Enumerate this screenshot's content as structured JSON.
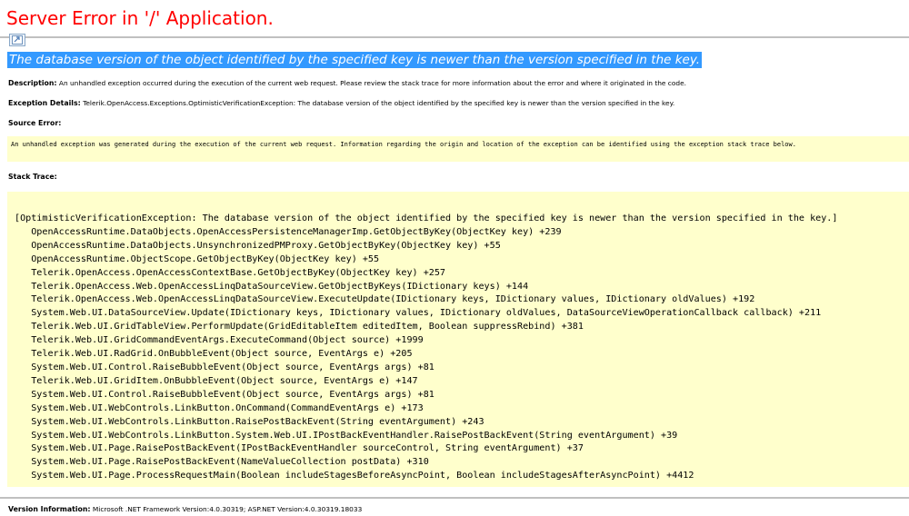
{
  "page": {
    "title": "Server Error in '/' Application.",
    "error_message": "The database version of the object identified by the specified key is newer than the version specified in the key."
  },
  "description": {
    "label": "Description:",
    "text": "An unhandled exception occurred during the execution of the current web request. Please review the stack trace for more information about the error and where it originated in the code."
  },
  "exception_details": {
    "label": "Exception Details:",
    "text": "Telerik.OpenAccess.Exceptions.OptimisticVerificationException: The database version of the object identified by the specified key is newer than the version specified in the key."
  },
  "source_error": {
    "label": "Source Error:",
    "text": "An unhandled exception was generated during the execution of the current web request. Information regarding the origin and location of the exception can be identified using the exception stack trace below."
  },
  "stack_trace": {
    "label": "Stack Trace:",
    "lines": [
      "[OptimisticVerificationException: The database version of the object identified by the specified key is newer than the version specified in the key.]",
      "   OpenAccessRuntime.DataObjects.OpenAccessPersistenceManagerImp.GetObjectByKey(ObjectKey key) +239",
      "   OpenAccessRuntime.DataObjects.UnsynchronizedPMProxy.GetObjectByKey(ObjectKey key) +55",
      "   OpenAccessRuntime.ObjectScope.GetObjectByKey(ObjectKey key) +55",
      "   Telerik.OpenAccess.OpenAccessContextBase.GetObjectByKey(ObjectKey key) +257",
      "   Telerik.OpenAccess.Web.OpenAccessLinqDataSourceView.GetObjectByKeys(IDictionary keys) +144",
      "   Telerik.OpenAccess.Web.OpenAccessLinqDataSourceView.ExecuteUpdate(IDictionary keys, IDictionary values, IDictionary oldValues) +192",
      "   System.Web.UI.DataSourceView.Update(IDictionary keys, IDictionary values, IDictionary oldValues, DataSourceViewOperationCallback callback) +211",
      "   Telerik.Web.UI.GridTableView.PerformUpdate(GridEditableItem editedItem, Boolean suppressRebind) +381",
      "   Telerik.Web.UI.GridCommandEventArgs.ExecuteCommand(Object source) +1999",
      "   Telerik.Web.UI.RadGrid.OnBubbleEvent(Object source, EventArgs e) +205",
      "   System.Web.UI.Control.RaiseBubbleEvent(Object source, EventArgs args) +81",
      "   Telerik.Web.UI.GridItem.OnBubbleEvent(Object source, EventArgs e) +147",
      "   System.Web.UI.Control.RaiseBubbleEvent(Object source, EventArgs args) +81",
      "   System.Web.UI.WebControls.LinkButton.OnCommand(CommandEventArgs e) +173",
      "   System.Web.UI.WebControls.LinkButton.RaisePostBackEvent(String eventArgument) +243",
      "   System.Web.UI.WebControls.LinkButton.System.Web.UI.IPostBackEventHandler.RaisePostBackEvent(String eventArgument) +39",
      "   System.Web.UI.Page.RaisePostBackEvent(IPostBackEventHandler sourceControl, String eventArgument) +37",
      "   System.Web.UI.Page.RaisePostBackEvent(NameValueCollection postData) +310",
      "   System.Web.UI.Page.ProcessRequestMain(Boolean includeStagesBeforeAsyncPoint, Boolean includeStagesAfterAsyncPoint) +4412"
    ]
  },
  "version_info": {
    "label": "Version Information:",
    "text": "Microsoft .NET Framework Version:4.0.30319; ASP.NET Version:4.0.30319.18033"
  },
  "colors": {
    "title": "#ff0000",
    "error_highlight": "#3399ff",
    "code_background": "#ffffcc",
    "rule": "#c0c0c0"
  },
  "icons": {
    "broken_image": "broken-image-icon"
  }
}
